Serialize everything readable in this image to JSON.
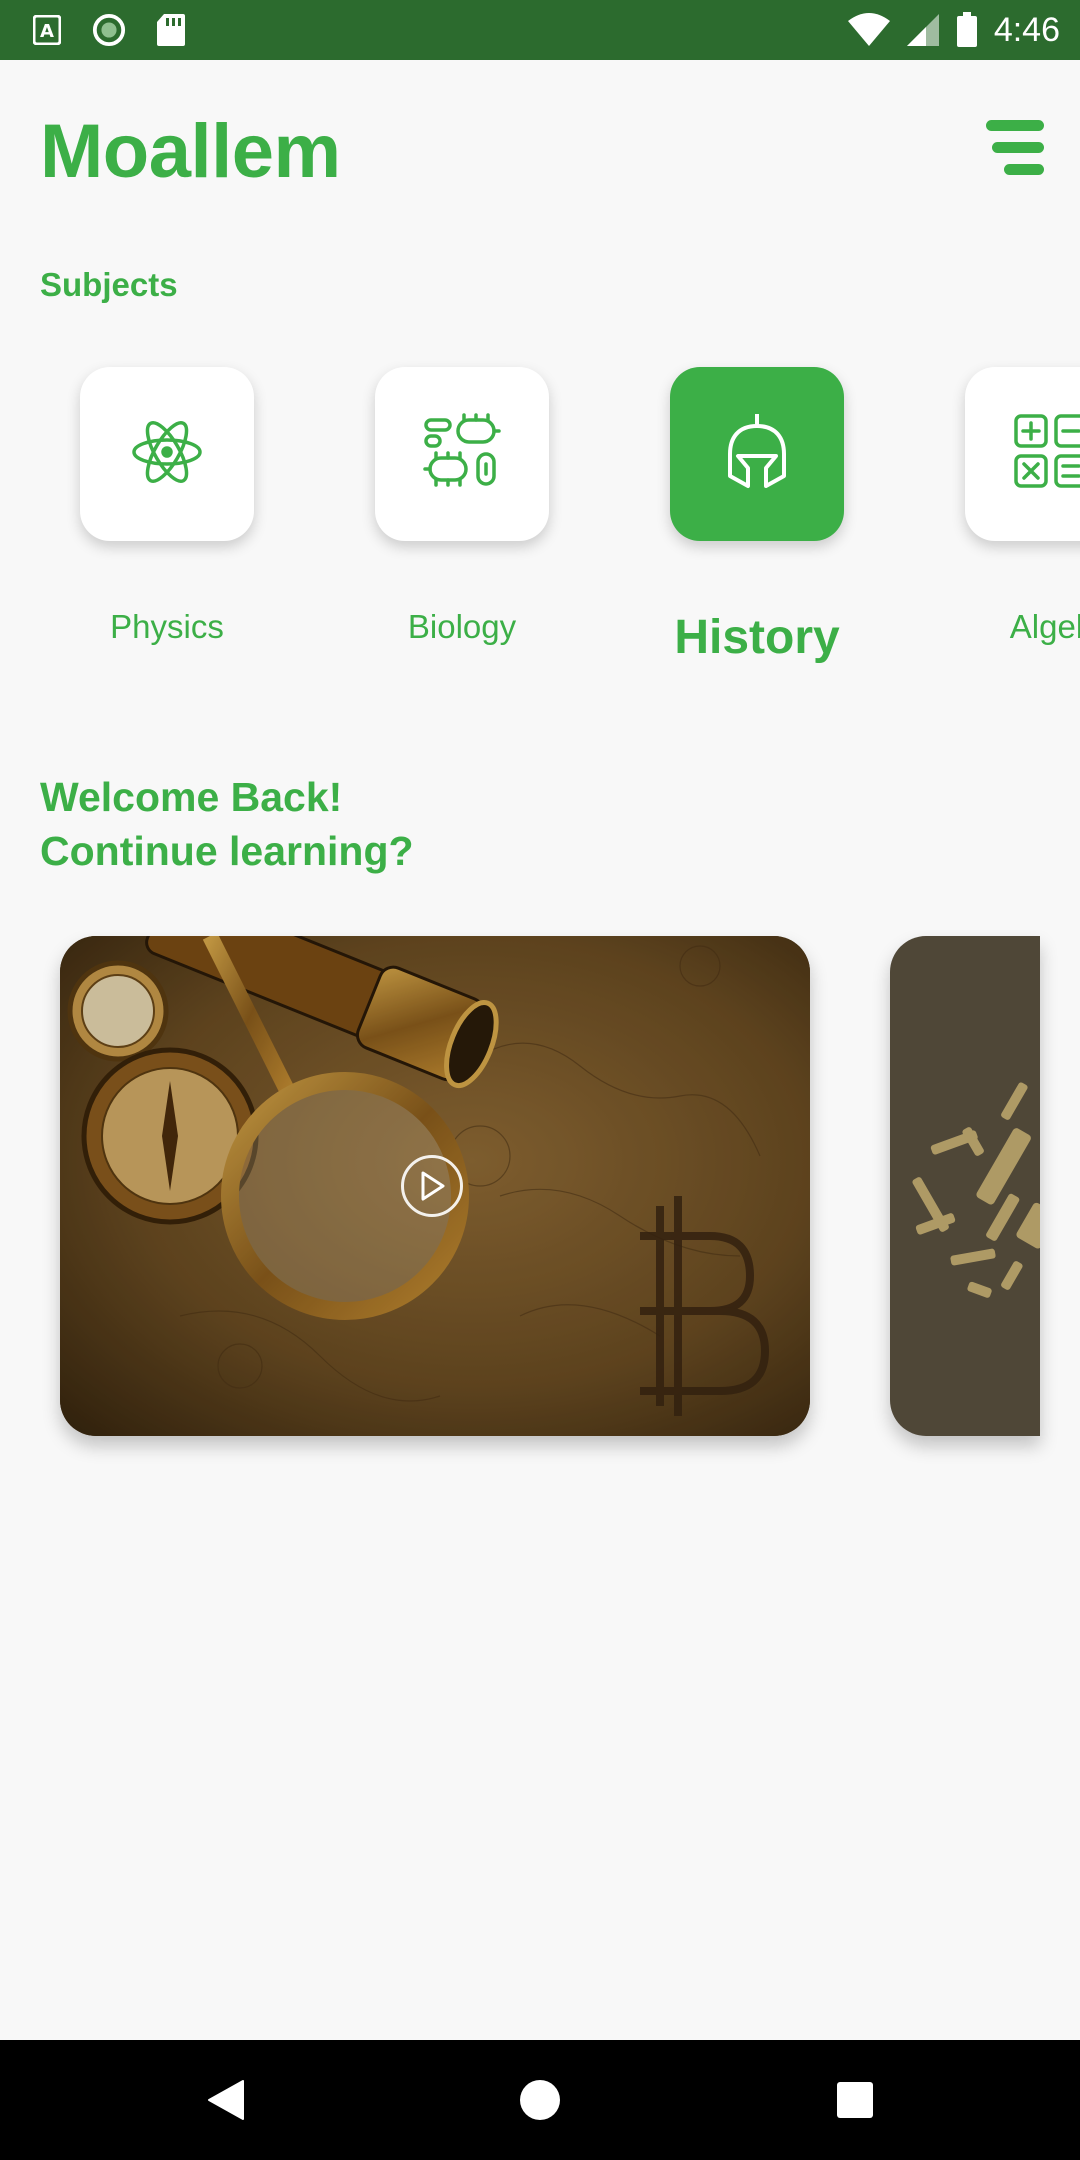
{
  "status_bar": {
    "time": "4:46",
    "icons": [
      "a-notification-icon",
      "circle-app-icon",
      "sd-card-icon",
      "wifi-icon",
      "signal-icon",
      "battery-icon"
    ]
  },
  "header": {
    "app_title": "Moallem",
    "menu_icon": "menu-icon"
  },
  "subjects": {
    "label": "Subjects",
    "items": [
      {
        "name": "Physics",
        "icon": "atom-icon",
        "active": false
      },
      {
        "name": "Biology",
        "icon": "microbe-icon",
        "active": false
      },
      {
        "name": "History",
        "icon": "helmet-icon",
        "active": true
      },
      {
        "name": "Algeb",
        "icon": "calculator-icon",
        "active": false
      }
    ]
  },
  "welcome": {
    "line1": "Welcome Back!",
    "line2": "Continue learning?"
  },
  "cards": [
    {
      "icon": "play-icon",
      "theme": "history map with spyglass and compass"
    },
    {
      "theme": "word cloud"
    }
  ],
  "colors": {
    "accent": "#3caf47",
    "status_bar": "#2c6b2e",
    "background": "#f8f8f8"
  },
  "nav_bar": {
    "icons": [
      "back-icon",
      "home-icon",
      "recents-icon"
    ]
  }
}
